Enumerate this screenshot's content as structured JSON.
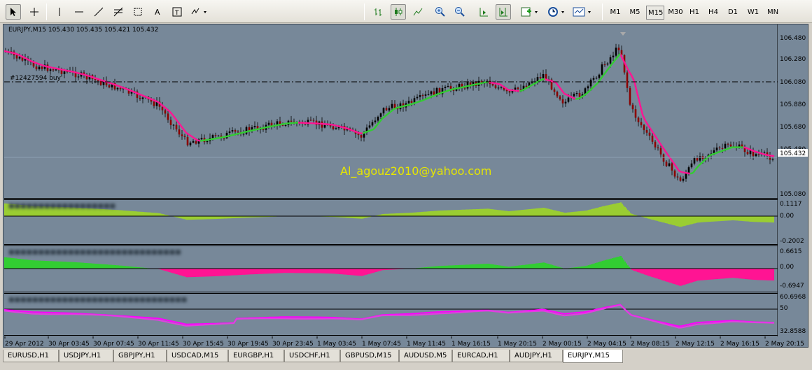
{
  "toolbar": {
    "timeframes": [
      "M1",
      "M5",
      "M15",
      "M30",
      "H1",
      "H4",
      "D1",
      "W1",
      "MN"
    ],
    "active_timeframe": "M15"
  },
  "chart": {
    "symbol_info": "EURJPY,M15  105.430 105.435 105.421 105.432",
    "order_label": "#12427594 buy",
    "watermark_text": "Al_agouz2010@yahoo.com",
    "current_price": "105.432",
    "price_labels": [
      "106.480",
      "106.280",
      "106.080",
      "105.880",
      "105.680",
      "105.480",
      "105.432",
      "105.080"
    ],
    "osc1_labels": [
      "0.1117",
      "0.00",
      "-0.2002"
    ],
    "osc2_labels": [
      "0.6615",
      "0.00",
      "-0.6947"
    ],
    "osc3_labels": [
      "60.6968",
      "50",
      "32.8588"
    ],
    "time_labels": [
      "29 Apr 2012",
      "30 Apr 03:45",
      "30 Apr 07:45",
      "30 Apr 11:45",
      "30 Apr 15:45",
      "30 Apr 19:45",
      "30 Apr 23:45",
      "1 May 03:45",
      "1 May 07:45",
      "1 May 11:45",
      "1 May 16:15",
      "1 May 20:15",
      "2 May 00:15",
      "2 May 04:15",
      "2 May 08:15",
      "2 May 12:15",
      "2 May 16:15",
      "2 May 20:15"
    ],
    "colors": {
      "background": "#778899",
      "bull_candle": "#000000",
      "bear_candle": "#8b0000",
      "ma_up": "#32cd32",
      "ma_down": "#ff1493",
      "osc1": "#9acd32",
      "osc2_pos": "#32cd32",
      "osc2_neg": "#ff1493",
      "osc3": "#ff00ff",
      "watermark": "#e6e600"
    }
  },
  "tabs": {
    "items": [
      "EURUSD,H1",
      "USDJPY,H1",
      "GBPJPY,H1",
      "USDCAD,M15",
      "EURGBP,H1",
      "USDCHF,H1",
      "GBPUSD,M15",
      "AUDUSD,M5",
      "EURCAD,H1",
      "AUDJPY,H1",
      "EURJPY,M15"
    ],
    "active": "EURJPY,M15"
  }
}
